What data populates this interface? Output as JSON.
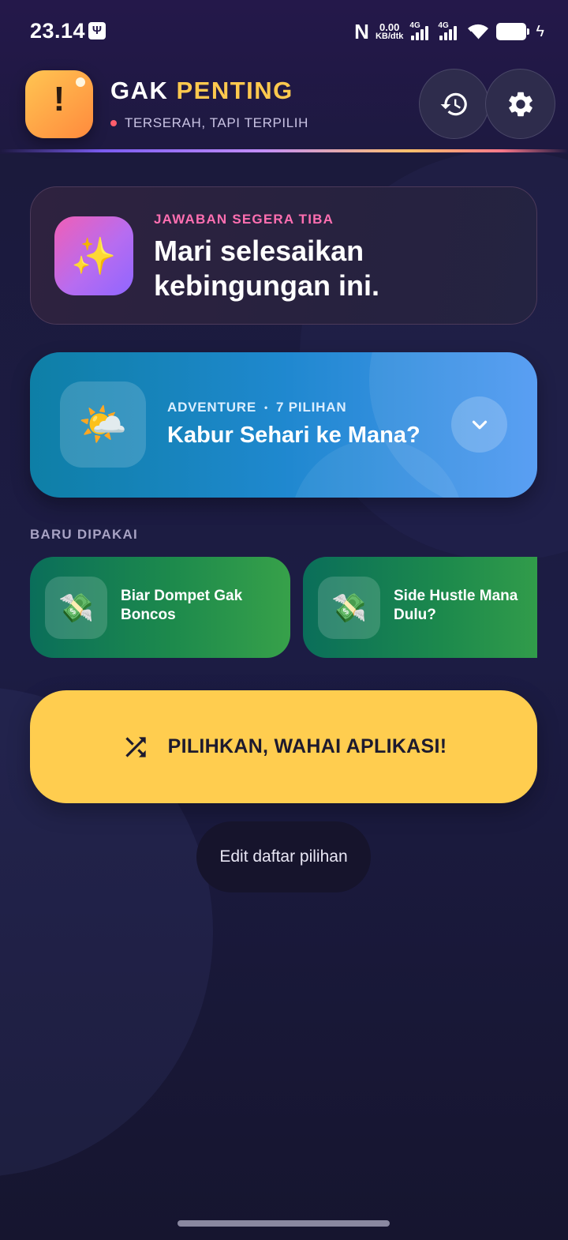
{
  "status_bar": {
    "time": "23.14",
    "usb_glyph": "Ψ",
    "nfc_glyph": "N",
    "net_speed_value": "0.00",
    "net_speed_unit": "KB/dtk",
    "sim1_label": "4G",
    "sim2_label": "4G",
    "charge_glyph": "ϟ",
    "icons": [
      "usb-icon",
      "nfc-icon",
      "signal-icon",
      "wifi-icon",
      "battery-icon",
      "charging-icon"
    ]
  },
  "header": {
    "logo_mark": "!",
    "title_part1": "GAK ",
    "title_part2": "PENTING",
    "subtitle": "TERSERAH, TAPI TERPILIH",
    "icons": [
      "history-icon",
      "gear-icon"
    ]
  },
  "prompt_card": {
    "icon_glyph": "✨",
    "eyebrow": "JAWABAN SEGERA TIBA",
    "title": "Mari selesaikan kebingungan ini."
  },
  "featured": {
    "icon_glyph": "🌤️",
    "category": "ADVENTURE",
    "separator": "•",
    "count": "7 PILIHAN",
    "title": "Kabur Sehari ke Mana?"
  },
  "recent": {
    "label": "BARU DIPAKAI",
    "items": [
      {
        "icon_glyph": "💸",
        "label": "Biar Dompet Gak Boncos"
      },
      {
        "icon_glyph": "💸",
        "label": "Side Hustle Mana Dulu?"
      }
    ]
  },
  "actions": {
    "cta_label": "PILIHKAN, WAHAI APLIKASI!",
    "edit_label": "Edit daftar pilihan"
  },
  "colors": {
    "background": "#181733",
    "accent_yellow": "#ffcd4f",
    "title_accent": "#ffc94e",
    "eyebrow_pink": "#ff6fb1",
    "featured_blue": "#1f88cf",
    "recent_green": "#1d8a4c"
  }
}
